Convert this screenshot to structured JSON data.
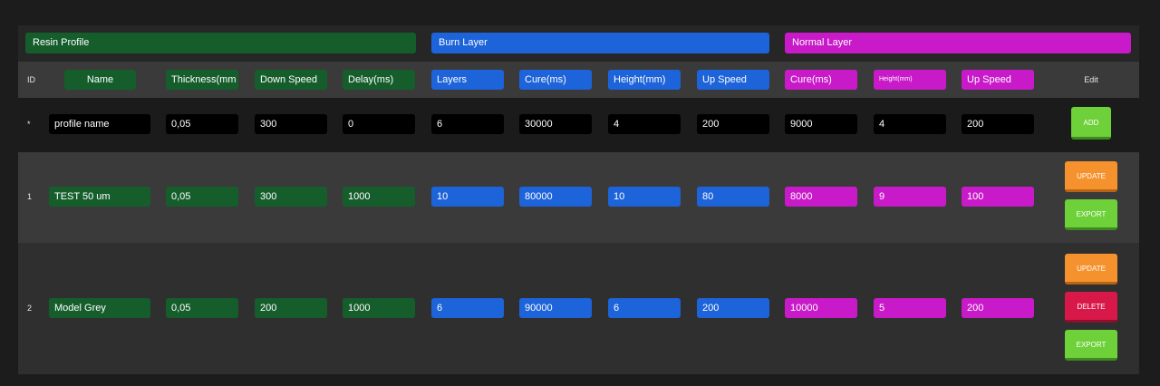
{
  "groups": {
    "resin": "Resin Profile",
    "burn": "Burn Layer",
    "normal": "Normal Layer"
  },
  "columns": {
    "id": "ID",
    "name": "Name",
    "thickness": "Thickness(mm",
    "down_speed": "Down Speed",
    "delay": "Delay(ms)",
    "burn_layers": "Layers",
    "burn_cure": "Cure(ms)",
    "burn_height": "Height(mm)",
    "burn_up_speed": "Up Speed",
    "normal_cure": "Cure(ms)",
    "normal_height": "Height(mm)",
    "normal_up_speed": "Up Speed",
    "edit": "Edit"
  },
  "new_row": {
    "id": "*",
    "name": "profile name",
    "thickness": "0,05",
    "down_speed": "300",
    "delay": "0",
    "burn_layers": "6",
    "burn_cure": "30000",
    "burn_height": "4",
    "burn_up_speed": "200",
    "normal_cure": "9000",
    "normal_height": "4",
    "normal_up_speed": "200",
    "add_label": "ADD"
  },
  "rows": [
    {
      "id": "1",
      "name": "TEST 50 um",
      "thickness": "0,05",
      "down_speed": "300",
      "delay": "1000",
      "burn_layers": "10",
      "burn_cure": "80000",
      "burn_height": "10",
      "burn_up_speed": "80",
      "normal_cure": "8000",
      "normal_height": "9",
      "normal_up_speed": "100",
      "update_label": "UPDATE",
      "export_label": "EXPORT"
    },
    {
      "id": "2",
      "name": "Model Grey",
      "thickness": "0,05",
      "down_speed": "200",
      "delay": "1000",
      "burn_layers": "6",
      "burn_cure": "90000",
      "burn_height": "6",
      "burn_up_speed": "200",
      "normal_cure": "10000",
      "normal_height": "5",
      "normal_up_speed": "200",
      "update_label": "UPDATE",
      "delete_label": "DELETE",
      "export_label": "EXPORT"
    }
  ],
  "colors": {
    "resin": "#155e2c",
    "burn": "#1d63d9",
    "normal": "#c81ac8",
    "add": "#6ed13a",
    "update": "#f5922e",
    "delete": "#d9184a"
  }
}
